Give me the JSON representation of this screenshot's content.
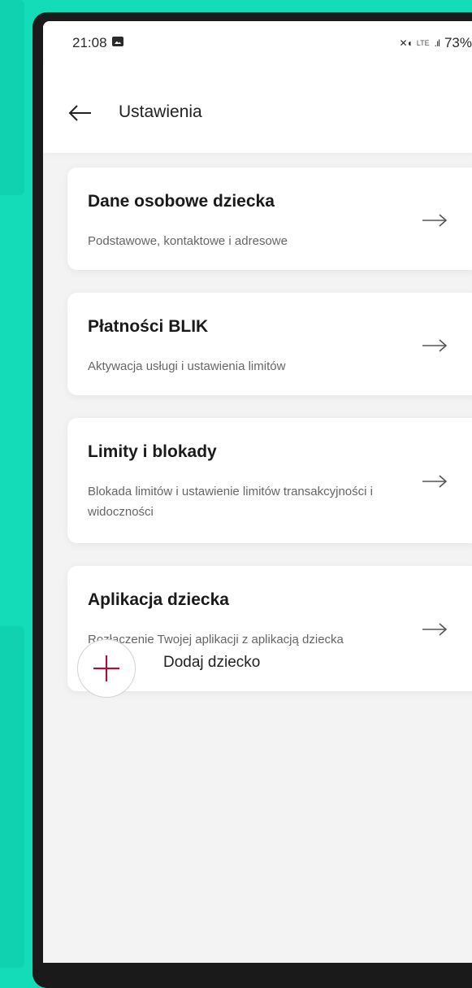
{
  "status_bar": {
    "time": "21:08",
    "battery": "73%",
    "network": "LTE"
  },
  "header": {
    "title": "Ustawienia"
  },
  "cards": [
    {
      "title": "Dane osobowe dziecka",
      "description": "Podstawowe, kontaktowe i adresowe"
    },
    {
      "title": "Płatności BLIK",
      "description": "Aktywacja usługi i ustawienia limitów"
    },
    {
      "title": "Limity i blokady",
      "description": "Blokada limitów i ustawienie limitów transakcyjności i widoczności"
    },
    {
      "title": "Aplikacja dziecka",
      "description": "Rozłączenie Twojej aplikacji z aplikacją dziecka"
    }
  ],
  "add_child": {
    "label": "Dodaj dziecko"
  },
  "colors": {
    "background": "#15dcb8",
    "accent": "#a0153e",
    "card": "#ffffff"
  },
  "icons": [
    "gallery-icon",
    "mute-icon",
    "lte-icon",
    "signal-icon",
    "back-arrow-icon",
    "arrow-right-icon",
    "plus-icon"
  ]
}
